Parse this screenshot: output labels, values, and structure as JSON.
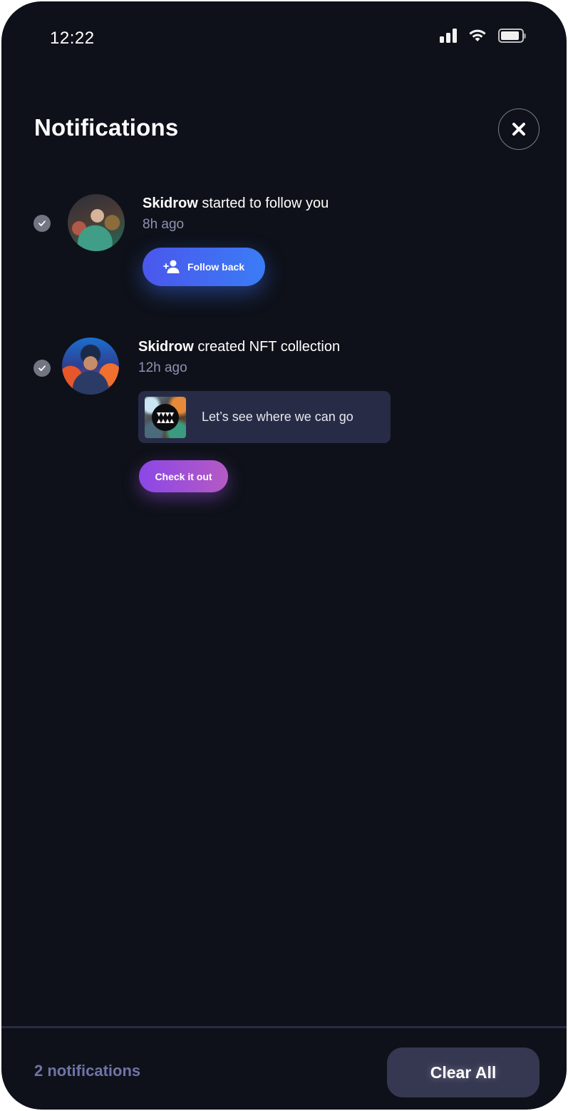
{
  "status_bar": {
    "time": "12:22",
    "icons": [
      "cellular-signal-icon",
      "wifi-icon",
      "battery-icon"
    ],
    "battery_level": 0.9
  },
  "header": {
    "title": "Notifications",
    "close_icon": "close-icon"
  },
  "notifications": [
    {
      "user": "Skidrow",
      "action": " started to follow you",
      "time": "8h ago",
      "read": true,
      "button_label": "Follow back",
      "button_icon": "add-user-icon"
    },
    {
      "user": "Skidrow",
      "action": " created NFT collection",
      "time": "12h ago",
      "read": true,
      "collection_title": "Let’s see where we can go",
      "button_label": "Check it out"
    }
  ],
  "footer": {
    "count_text": "2 notifications",
    "clear_label": "Clear All"
  },
  "colors": {
    "background": "#0e1119",
    "follow_button": "#4a57ec",
    "check_button": "#8b47e6",
    "card": "#282b45",
    "muted_text": "#8d92b0"
  }
}
